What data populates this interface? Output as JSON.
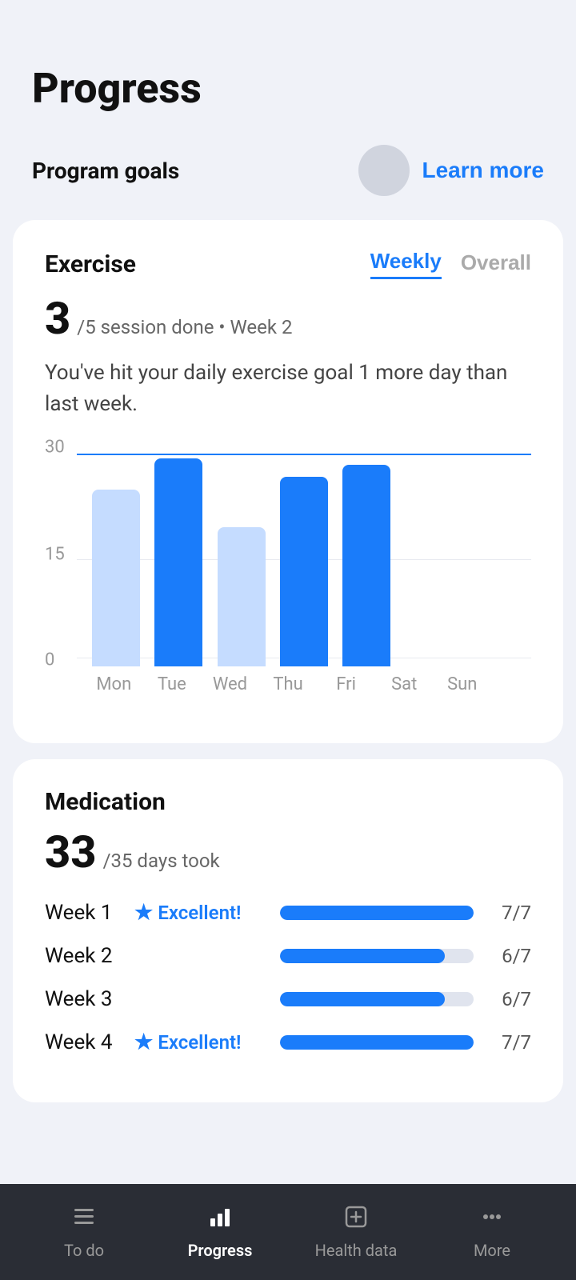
{
  "page": {
    "title": "Progress"
  },
  "programGoals": {
    "label": "Program goals",
    "learnMore": "Learn more"
  },
  "exercise": {
    "title": "Exercise",
    "tabs": [
      "Weekly",
      "Overall"
    ],
    "activeTab": "Weekly",
    "bigNum": "3",
    "countDetail": "/5 session done • Week 2",
    "description": "You've hit your daily exercise goal 1 more day than last week.",
    "chartYLabels": [
      "30",
      "15",
      "0"
    ],
    "chartGoalValue": 30,
    "chartMaxValue": 33,
    "bars": [
      {
        "day": "Mon",
        "value": 27,
        "type": "light"
      },
      {
        "day": "Tue",
        "value": 33,
        "type": "dark"
      },
      {
        "day": "Wed",
        "value": 22,
        "type": "light"
      },
      {
        "day": "Thu",
        "value": 30,
        "type": "dark"
      },
      {
        "day": "Fri",
        "value": 32,
        "type": "dark"
      },
      {
        "day": "Sat",
        "value": 0,
        "type": "empty"
      },
      {
        "day": "Sun",
        "value": 0,
        "type": "empty"
      }
    ]
  },
  "medication": {
    "title": "Medication",
    "bigNum": "33",
    "detail": "/35 days took",
    "weeks": [
      {
        "label": "Week 1",
        "badge": "Excellent!",
        "hasBadge": true,
        "score": "7/7",
        "fillPct": 100
      },
      {
        "label": "Week 2",
        "badge": "",
        "hasBadge": false,
        "score": "6/7",
        "fillPct": 85
      },
      {
        "label": "Week 3",
        "badge": "",
        "hasBadge": false,
        "score": "6/7",
        "fillPct": 85
      },
      {
        "label": "Week 4",
        "badge": "Excellent!",
        "hasBadge": true,
        "score": "7/7",
        "fillPct": 100
      }
    ]
  },
  "bottomNav": {
    "items": [
      {
        "label": "To do",
        "icon": "☰",
        "active": false
      },
      {
        "label": "Progress",
        "icon": "📊",
        "active": true
      },
      {
        "label": "Health data",
        "icon": "➕",
        "active": false
      },
      {
        "label": "More",
        "icon": "···",
        "active": false
      }
    ]
  }
}
